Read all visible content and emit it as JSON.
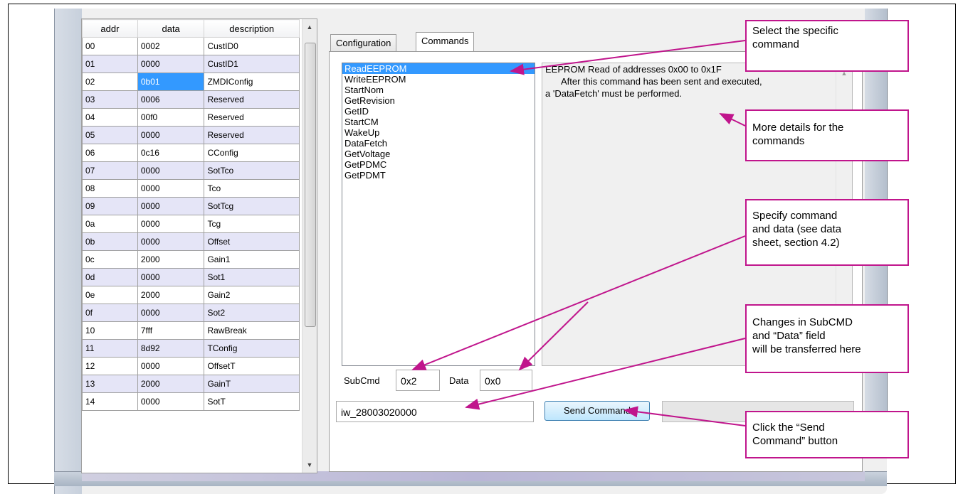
{
  "grid": {
    "headers": [
      "addr",
      "data",
      "description"
    ],
    "rows": [
      [
        "00",
        "0002",
        "CustID0"
      ],
      [
        "01",
        "0000",
        "CustID1"
      ],
      [
        "02",
        "0b01",
        "ZMDIConfig"
      ],
      [
        "03",
        "0006",
        "Reserved"
      ],
      [
        "04",
        "00f0",
        "Reserved"
      ],
      [
        "05",
        "0000",
        "Reserved"
      ],
      [
        "06",
        "0c16",
        "CConfig"
      ],
      [
        "07",
        "0000",
        "SotTco"
      ],
      [
        "08",
        "0000",
        "Tco"
      ],
      [
        "09",
        "0000",
        "SotTcg"
      ],
      [
        "0a",
        "0000",
        "Tcg"
      ],
      [
        "0b",
        "0000",
        "Offset"
      ],
      [
        "0c",
        "2000",
        "Gain1"
      ],
      [
        "0d",
        "0000",
        "Sot1"
      ],
      [
        "0e",
        "2000",
        "Gain2"
      ],
      [
        "0f",
        "0000",
        "Sot2"
      ],
      [
        "10",
        "7fff",
        "RawBreak"
      ],
      [
        "11",
        "8d92",
        "TConfig"
      ],
      [
        "12",
        "0000",
        "OffsetT"
      ],
      [
        "13",
        "2000",
        "GainT"
      ],
      [
        "14",
        "0000",
        "SotT"
      ]
    ]
  },
  "tabs": {
    "configuration": "Configuration",
    "commands": "Commands"
  },
  "commands": [
    "ReadEEPROM",
    "WriteEEPROM",
    "StartNom",
    "GetRevision",
    "GetID",
    "StartCM",
    "WakeUp",
    "DataFetch",
    "GetVoltage",
    "GetPDMC",
    "GetPDMT"
  ],
  "description": {
    "line1": "EEPROM Read of addresses 0x00 to 0x1F",
    "line2": "After this command has been sent and executed,",
    "line3": "a 'DataFetch' must be performed."
  },
  "subcmd": {
    "label": "SubCmd",
    "value": "0x2"
  },
  "data_field": {
    "label": "Data",
    "value": "0x0"
  },
  "command_string": "iw_28003020000",
  "send_button": "Send Command",
  "callouts": {
    "select": [
      "Select the specific",
      "command"
    ],
    "details": [
      "More details for the",
      "commands"
    ],
    "specify": [
      "Specify command",
      "and data (see data",
      "sheet, section 4.2)"
    ],
    "changes": [
      "Changes in SubCMD",
      "and “Data” field",
      "will be transferred here"
    ],
    "click": [
      "Click the “Send",
      "Command” button"
    ]
  },
  "colors": {
    "callout": "#c0158c",
    "selection": "#3399ff",
    "alt_row": "#e5e5f7"
  }
}
